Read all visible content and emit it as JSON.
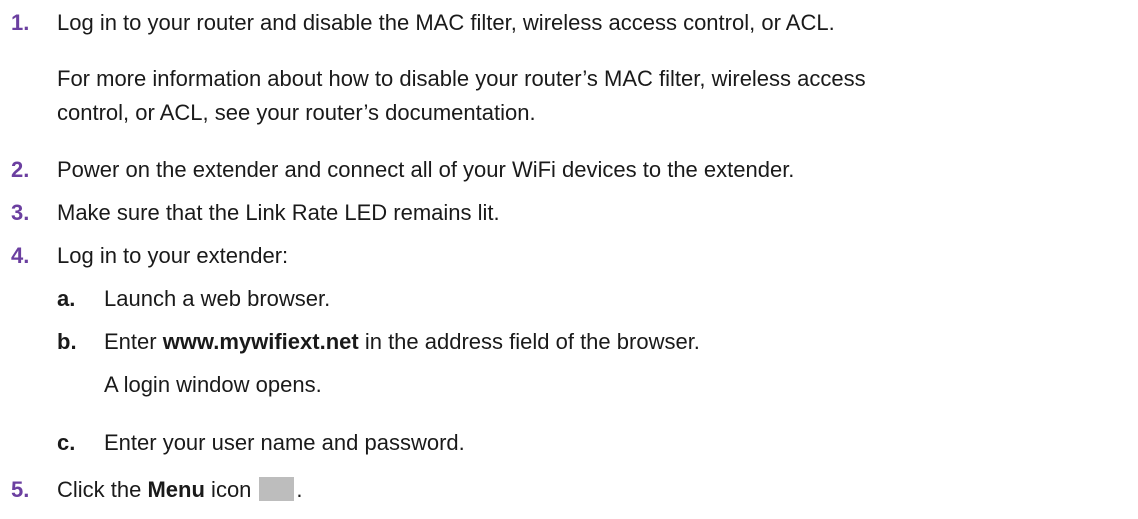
{
  "steps": [
    {
      "number": "1.",
      "text": "Log in to your router and disable the MAC filter, wireless access control, or ACL.",
      "note_line1": "For more information about how to disable your router’s MAC filter, wireless access",
      "note_line2": "control, or ACL, see your router’s documentation."
    },
    {
      "number": "2.",
      "text": "Power on the extender and connect all of your WiFi devices to the extender."
    },
    {
      "number": "3.",
      "text": "Make sure that the Link Rate LED remains lit."
    },
    {
      "number": "4.",
      "text": "Log in to your extender:",
      "substeps": [
        {
          "letter": "a.",
          "text": "Launch a web browser."
        },
        {
          "letter": "b.",
          "text_before": "Enter ",
          "bold": "www.mywifiext.net",
          "text_after": " in the address field of the browser.",
          "note": "A login window opens."
        },
        {
          "letter": "c.",
          "text": "Enter your user name and password."
        }
      ]
    },
    {
      "number": "5.",
      "text_before": "Click the ",
      "bold": "Menu",
      "text_after": " icon",
      "end": ".",
      "icon": "menu-icon"
    }
  ]
}
